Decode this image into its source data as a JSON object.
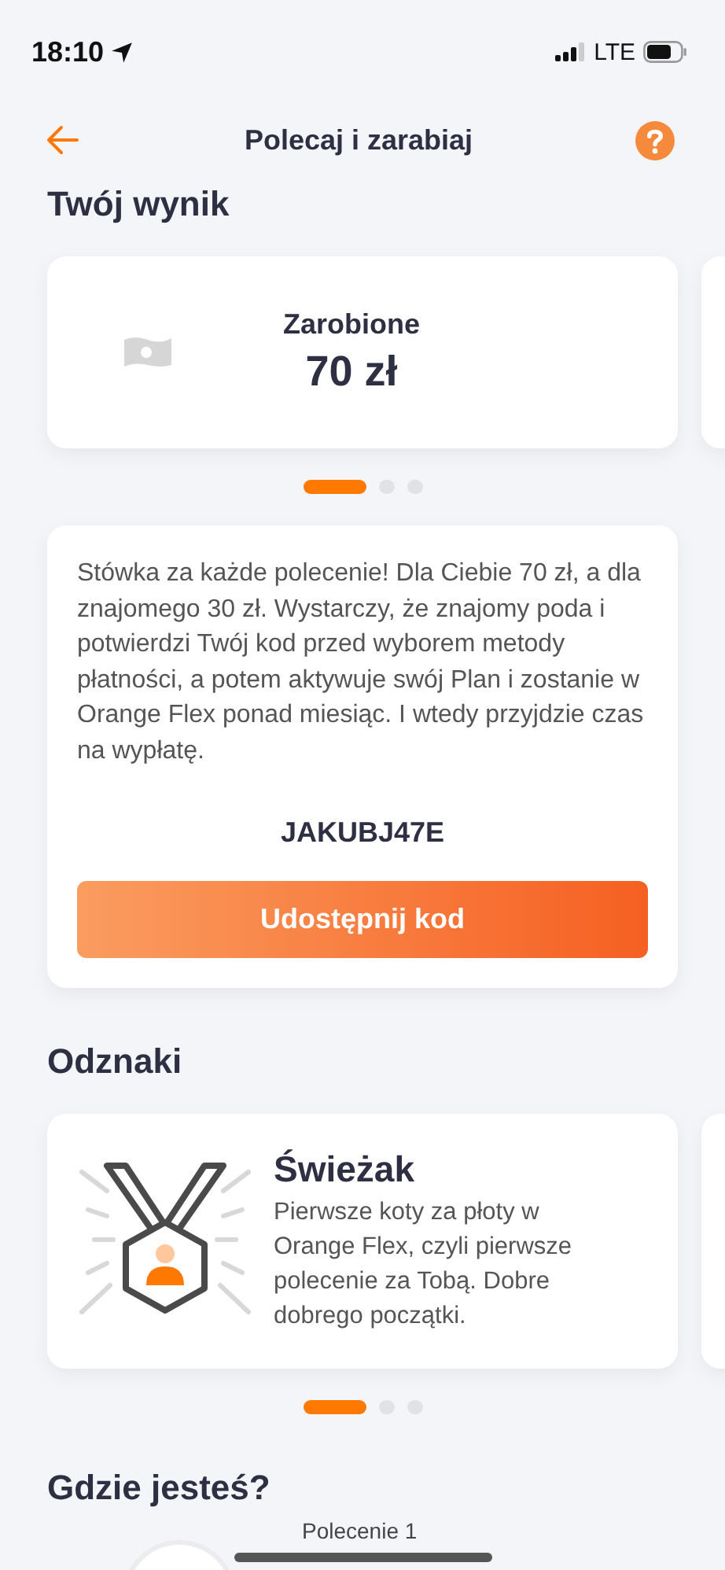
{
  "status_bar": {
    "time": "18:10",
    "network": "LTE"
  },
  "header": {
    "title": "Polecaj i zarabiaj"
  },
  "score": {
    "heading": "Twój wynik",
    "card": {
      "label": "Zarobione",
      "value": "70 zł"
    },
    "dots": [
      {
        "selected": true
      },
      {
        "selected": false
      },
      {
        "selected": false
      }
    ]
  },
  "referral": {
    "text": "Stówka za każde polecenie! Dla Ciebie 70 zł, a dla znajomego 30 zł. Wystarczy, że znajomy poda i potwierdzi Twój kod przed wyborem metody płatności, a potem aktywuje swój Plan i zostanie w Orange Flex ponad miesiąc. I wtedy przyjdzie czas na wypłatę.",
    "code": "JAKUBJ47E",
    "button": "Udostępnij kod"
  },
  "badges": {
    "heading": "Odznaki",
    "card": {
      "title": "Świeżak",
      "description": "Pierwsze koty za płoty w Orange Flex, czyli pierwsze polecenie za Tobą. Dobre dobrego początki."
    },
    "dots": [
      {
        "selected": true
      },
      {
        "selected": false
      },
      {
        "selected": false
      }
    ]
  },
  "progress": {
    "heading": "Gdzie jesteś?",
    "step": "Polecenie 1"
  }
}
